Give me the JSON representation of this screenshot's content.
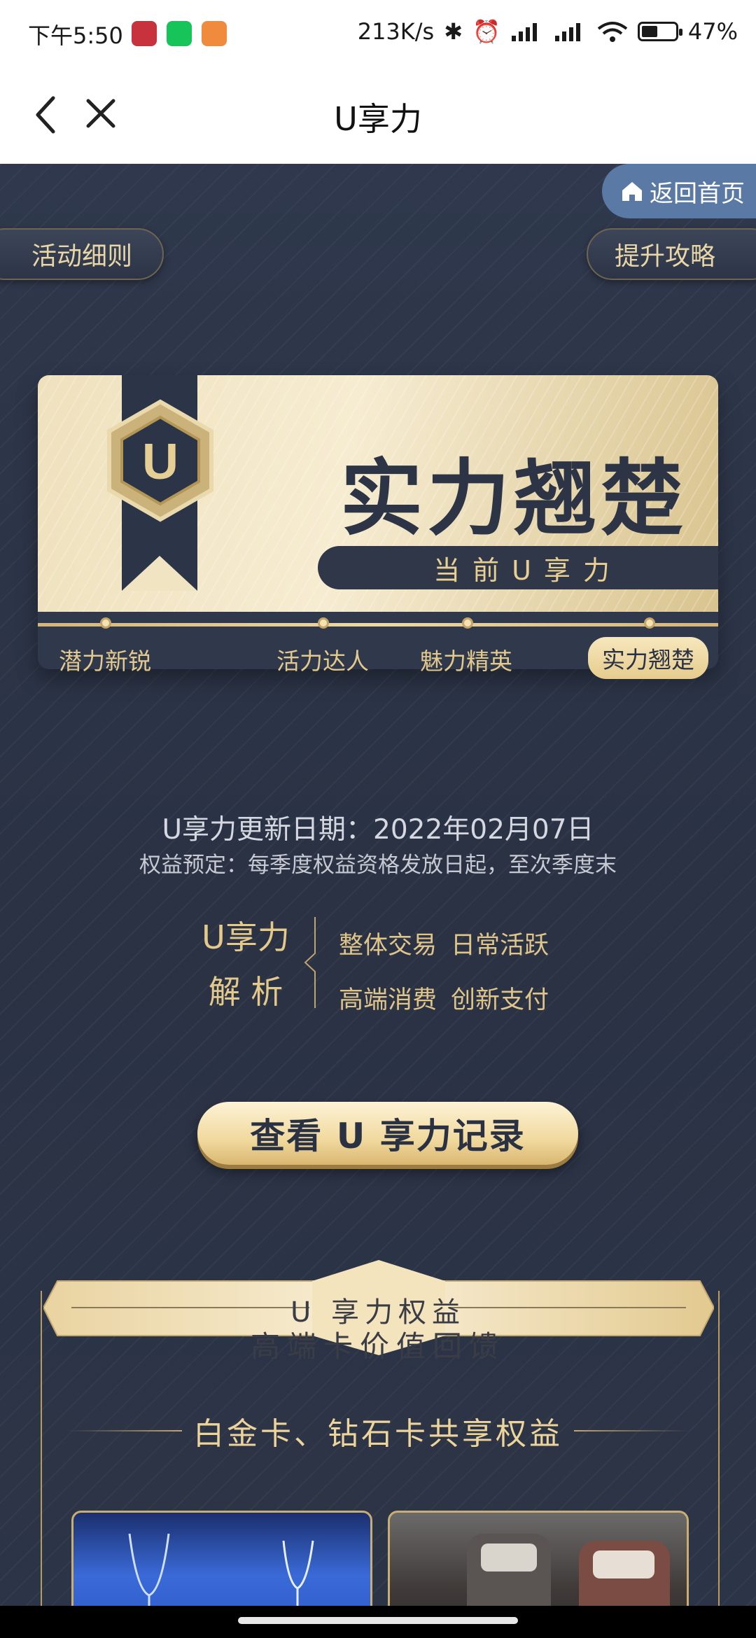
{
  "status_bar": {
    "time": "下午5:50",
    "net_speed": "213K/s",
    "battery": "47%",
    "battery_level": 0.47
  },
  "header": {
    "title": "U享力"
  },
  "top_actions": {
    "home": "返回首页",
    "rules": "活动细则",
    "upgrade": "提升攻略"
  },
  "level_card": {
    "current_level": "实力翘楚",
    "current_label": "当前U享力",
    "levels": [
      "潜力新锐",
      "活力达人",
      "魅力精英",
      "实力翘楚"
    ],
    "active_index": 3
  },
  "info": {
    "update_date": "U享力更新日期：2022年02月07日",
    "rights_note": "权益预定：每季度权益资格发放日起，至次季度末"
  },
  "analysis": {
    "title_line1": "U享力",
    "title_line2": "解 析",
    "items_row1": [
      "整体交易",
      "日常活跃"
    ],
    "items_row2": [
      "高端消费",
      "创新支付"
    ]
  },
  "record_button": "查看 U 享力记录",
  "rights": {
    "title1": "U 享力权益",
    "title2": "高端卡价值回馈",
    "shared": "白金卡、钻石卡共享权益"
  },
  "colors": {
    "gold": "#e4c98c",
    "navy": "#2c3447",
    "home_blue": "#5a7aa5"
  }
}
